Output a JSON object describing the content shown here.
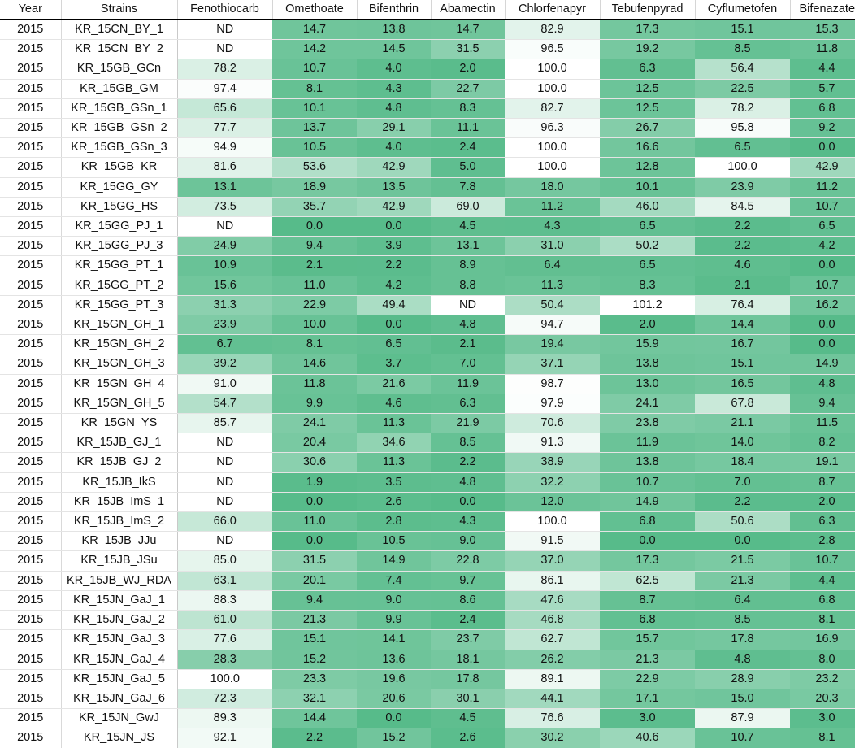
{
  "table": {
    "columns": [
      "Year",
      "Strains",
      "Fenothiocarb",
      "Omethoate",
      "Bifenthrin",
      "Abamectin",
      "Chlorfenapyr",
      "Tebufenpyrad",
      "Cyflumetofen",
      "Bifenazate"
    ],
    "nd_label": "ND",
    "heat": {
      "low_color": "#57bb8a",
      "high_color": "#ffffff",
      "min": 0,
      "max": 100
    },
    "rows": [
      [
        "2015",
        "KR_15CN_BY_1",
        "ND",
        "14.7",
        "13.8",
        "14.7",
        "82.9",
        "17.3",
        "15.1",
        "15.3"
      ],
      [
        "2015",
        "KR_15CN_BY_2",
        "ND",
        "14.2",
        "14.5",
        "31.5",
        "96.5",
        "19.2",
        "8.5",
        "11.8"
      ],
      [
        "2015",
        "KR_15GB_GCn",
        "78.2",
        "10.7",
        "4.0",
        "2.0",
        "100.0",
        "6.3",
        "56.4",
        "4.4"
      ],
      [
        "2015",
        "KR_15GB_GM",
        "97.4",
        "8.1",
        "4.3",
        "22.7",
        "100.0",
        "12.5",
        "22.5",
        "5.7"
      ],
      [
        "2015",
        "KR_15GB_GSn_1",
        "65.6",
        "10.1",
        "4.8",
        "8.3",
        "82.7",
        "12.5",
        "78.2",
        "6.8"
      ],
      [
        "2015",
        "KR_15GB_GSn_2",
        "77.7",
        "13.7",
        "29.1",
        "11.1",
        "96.3",
        "26.7",
        "95.8",
        "9.2"
      ],
      [
        "2015",
        "KR_15GB_GSn_3",
        "94.9",
        "10.5",
        "4.0",
        "2.4",
        "100.0",
        "16.6",
        "6.5",
        "0.0"
      ],
      [
        "2015",
        "KR_15GB_KR",
        "81.6",
        "53.6",
        "42.9",
        "5.0",
        "100.0",
        "12.8",
        "100.0",
        "42.9"
      ],
      [
        "2015",
        "KR_15GG_GY",
        "13.1",
        "18.9",
        "13.5",
        "7.8",
        "18.0",
        "10.1",
        "23.9",
        "11.2"
      ],
      [
        "2015",
        "KR_15GG_HS",
        "73.5",
        "35.7",
        "42.9",
        "69.0",
        "11.2",
        "46.0",
        "84.5",
        "10.7"
      ],
      [
        "2015",
        "KR_15GG_PJ_1",
        "ND",
        "0.0",
        "0.0",
        "4.5",
        "4.3",
        "6.5",
        "2.2",
        "6.5"
      ],
      [
        "2015",
        "KR_15GG_PJ_3",
        "24.9",
        "9.4",
        "3.9",
        "13.1",
        "31.0",
        "50.2",
        "2.2",
        "4.2"
      ],
      [
        "2015",
        "KR_15GG_PT_1",
        "10.9",
        "2.1",
        "2.2",
        "8.9",
        "6.4",
        "6.5",
        "4.6",
        "0.0"
      ],
      [
        "2015",
        "KR_15GG_PT_2",
        "15.6",
        "11.0",
        "4.2",
        "8.8",
        "11.3",
        "8.3",
        "2.1",
        "10.7"
      ],
      [
        "2015",
        "KR_15GG_PT_3",
        "31.3",
        "22.9",
        "49.4",
        "ND",
        "50.4",
        "101.2",
        "76.4",
        "16.2"
      ],
      [
        "2015",
        "KR_15GN_GH_1",
        "23.9",
        "10.0",
        "0.0",
        "4.8",
        "94.7",
        "2.0",
        "14.4",
        "0.0"
      ],
      [
        "2015",
        "KR_15GN_GH_2",
        "6.7",
        "8.1",
        "6.5",
        "2.1",
        "19.4",
        "15.9",
        "16.7",
        "0.0"
      ],
      [
        "2015",
        "KR_15GN_GH_3",
        "39.2",
        "14.6",
        "3.7",
        "7.0",
        "37.1",
        "13.8",
        "15.1",
        "14.9"
      ],
      [
        "2015",
        "KR_15GN_GH_4",
        "91.0",
        "11.8",
        "21.6",
        "11.9",
        "98.7",
        "13.0",
        "16.5",
        "4.8"
      ],
      [
        "2015",
        "KR_15GN_GH_5",
        "54.7",
        "9.9",
        "4.6",
        "6.3",
        "97.9",
        "24.1",
        "67.8",
        "9.4"
      ],
      [
        "2015",
        "KR_15GN_YS",
        "85.7",
        "24.1",
        "11.3",
        "21.9",
        "70.6",
        "23.8",
        "21.1",
        "11.5"
      ],
      [
        "2015",
        "KR_15JB_GJ_1",
        "ND",
        "20.4",
        "34.6",
        "8.5",
        "91.3",
        "11.9",
        "14.0",
        "8.2"
      ],
      [
        "2015",
        "KR_15JB_GJ_2",
        "ND",
        "30.6",
        "11.3",
        "2.2",
        "38.9",
        "13.8",
        "18.4",
        "19.1"
      ],
      [
        "2015",
        "KR_15JB_IkS",
        "ND",
        "1.9",
        "3.5",
        "4.8",
        "32.2",
        "10.7",
        "7.0",
        "8.7"
      ],
      [
        "2015",
        "KR_15JB_ImS_1",
        "ND",
        "0.0",
        "2.6",
        "0.0",
        "12.0",
        "14.9",
        "2.2",
        "2.0"
      ],
      [
        "2015",
        "KR_15JB_ImS_2",
        "66.0",
        "11.0",
        "2.8",
        "4.3",
        "100.0",
        "6.8",
        "50.6",
        "6.3"
      ],
      [
        "2015",
        "KR_15JB_JJu",
        "ND",
        "0.0",
        "10.5",
        "9.0",
        "91.5",
        "0.0",
        "0.0",
        "2.8"
      ],
      [
        "2015",
        "KR_15JB_JSu",
        "85.0",
        "31.5",
        "14.9",
        "22.8",
        "37.0",
        "17.3",
        "21.5",
        "10.7"
      ],
      [
        "2015",
        "KR_15JB_WJ_RDA",
        "63.1",
        "20.1",
        "7.4",
        "9.7",
        "86.1",
        "62.5",
        "21.3",
        "4.4"
      ],
      [
        "2015",
        "KR_15JN_GaJ_1",
        "88.3",
        "9.4",
        "9.0",
        "8.6",
        "47.6",
        "8.7",
        "6.4",
        "6.8"
      ],
      [
        "2015",
        "KR_15JN_GaJ_2",
        "61.0",
        "21.3",
        "9.9",
        "2.4",
        "46.8",
        "6.8",
        "8.5",
        "8.1"
      ],
      [
        "2015",
        "KR_15JN_GaJ_3",
        "77.6",
        "15.1",
        "14.1",
        "23.7",
        "62.7",
        "15.7",
        "17.8",
        "16.9"
      ],
      [
        "2015",
        "KR_15JN_GaJ_4",
        "28.3",
        "15.2",
        "13.6",
        "18.1",
        "26.2",
        "21.3",
        "4.8",
        "8.0"
      ],
      [
        "2015",
        "KR_15JN_GaJ_5",
        "100.0",
        "23.3",
        "19.6",
        "17.8",
        "89.1",
        "22.9",
        "28.9",
        "23.2"
      ],
      [
        "2015",
        "KR_15JN_GaJ_6",
        "72.3",
        "32.1",
        "20.6",
        "30.1",
        "44.1",
        "17.1",
        "15.0",
        "20.3"
      ],
      [
        "2015",
        "KR_15JN_GwJ",
        "89.3",
        "14.4",
        "0.0",
        "4.5",
        "76.6",
        "3.0",
        "87.9",
        "3.0"
      ],
      [
        "2015",
        "KR_15JN_JS",
        "92.1",
        "2.2",
        "15.2",
        "2.6",
        "30.2",
        "40.6",
        "10.7",
        "8.1"
      ]
    ]
  }
}
